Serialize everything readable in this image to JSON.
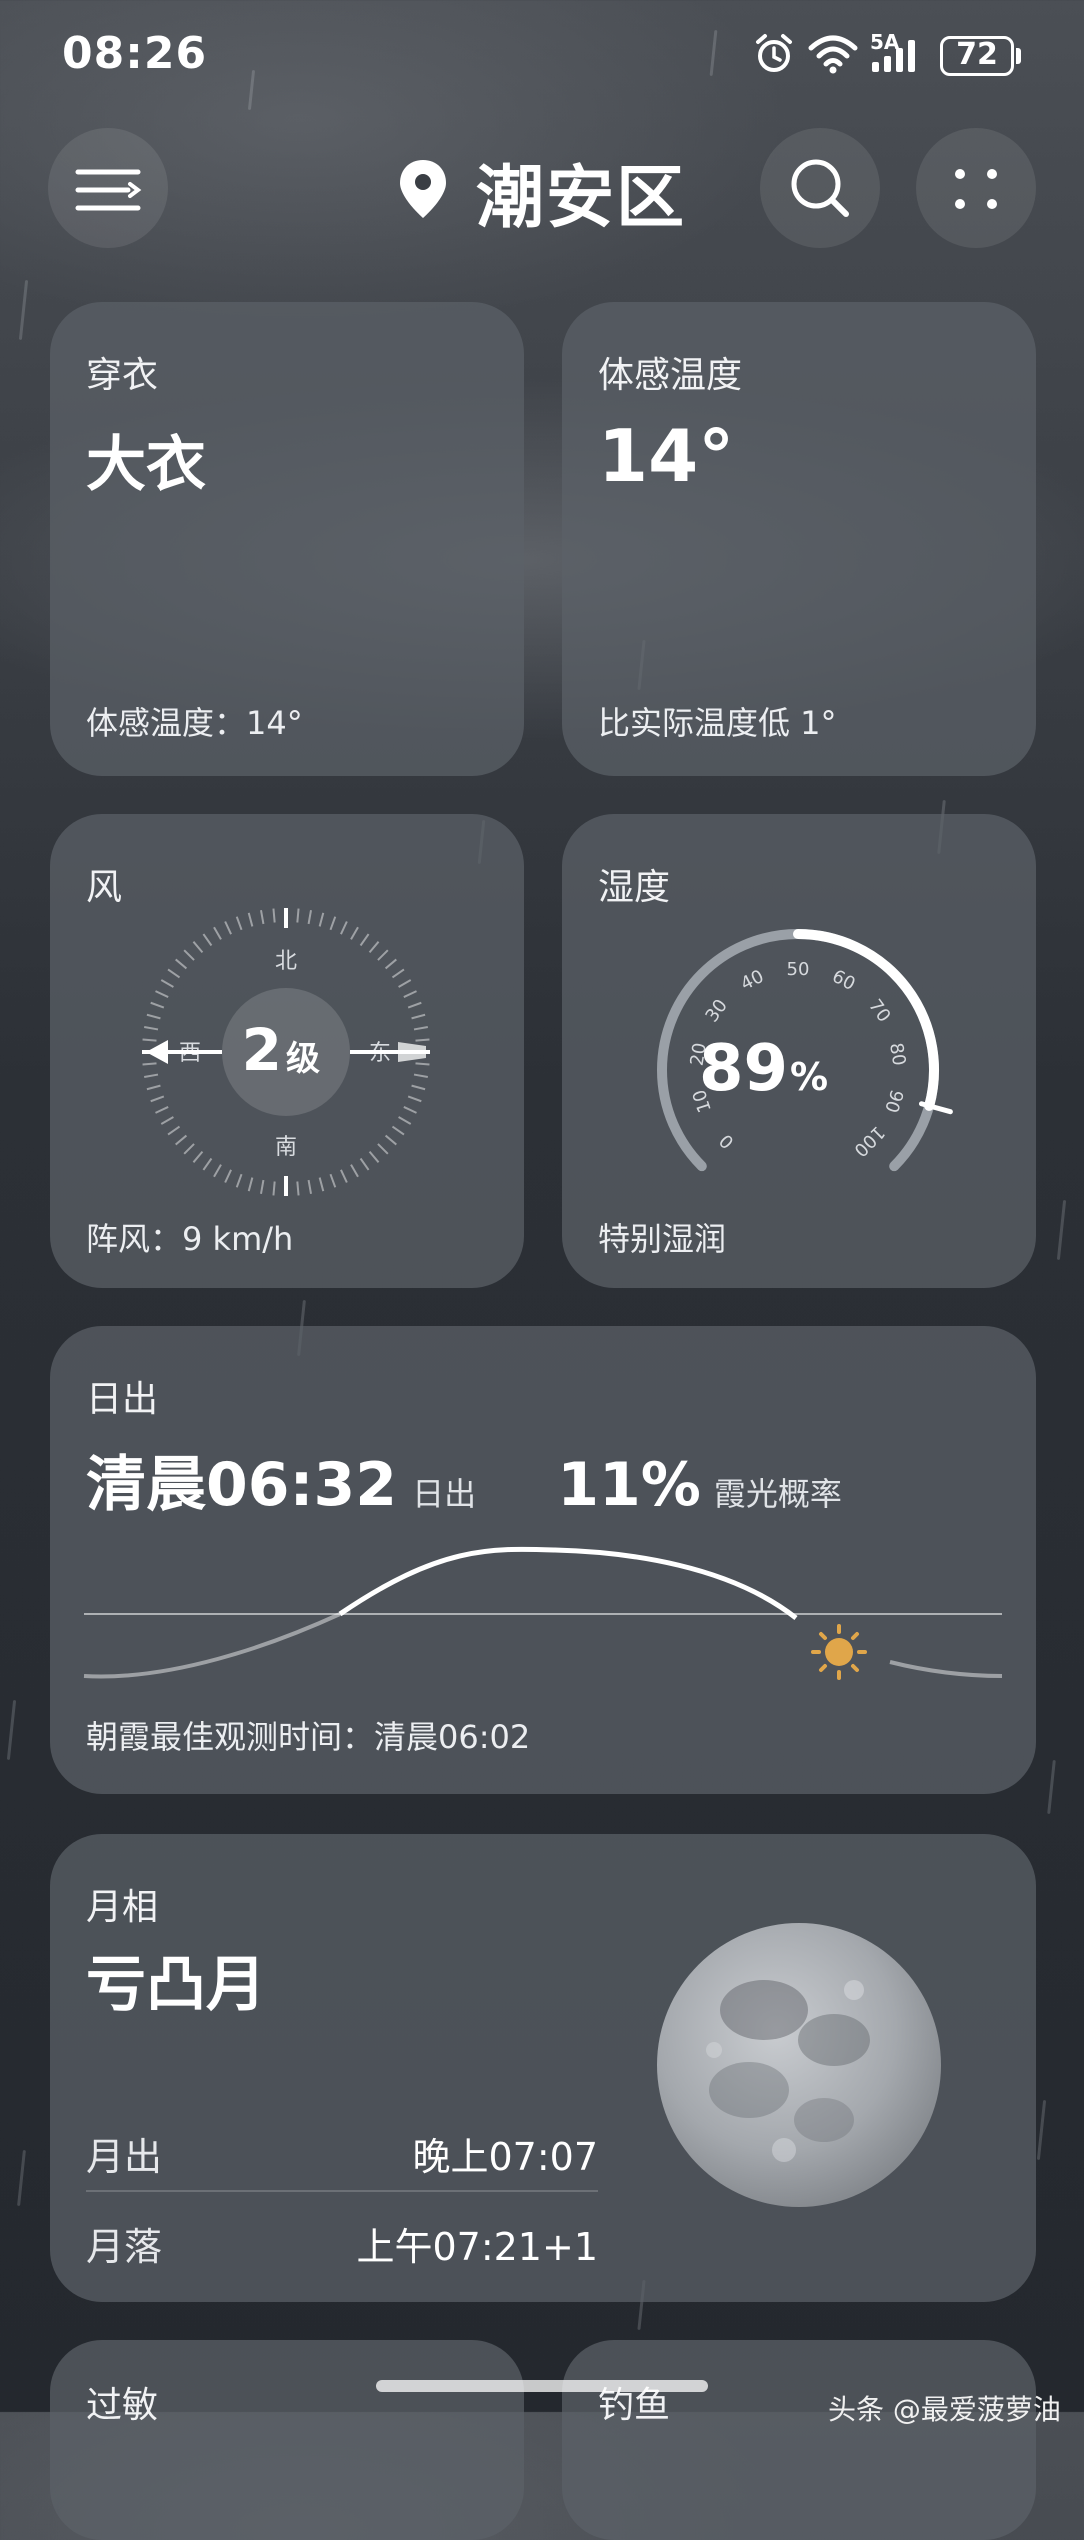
{
  "status_bar": {
    "time": "08:26",
    "network": "5A",
    "battery": "72",
    "icons": [
      "alarm-icon",
      "wifi-icon",
      "signal-icon",
      "battery-icon"
    ]
  },
  "header": {
    "city": "潮安区",
    "icons": [
      "menu-icon",
      "location-pin-icon",
      "search-icon",
      "more-icon"
    ]
  },
  "clothing": {
    "title": "穿衣",
    "value": "大衣",
    "footer": "体感温度：14°"
  },
  "feels_like": {
    "title": "体感温度",
    "value": "14°",
    "footer": "比实际温度低 1°"
  },
  "wind": {
    "title": "风",
    "level_number": "2",
    "level_unit": "级",
    "dir_north": "北",
    "dir_south": "南",
    "dir_west": "西",
    "dir_east": "东",
    "footer": "阵风：9 km/h"
  },
  "humidity": {
    "title": "湿度",
    "value_number": "89",
    "value_unit": "%",
    "level": 89,
    "ticks": [
      "0",
      "10",
      "20",
      "30",
      "40",
      "50",
      "60",
      "70",
      "80",
      "90",
      "100"
    ],
    "footer": "特别湿润"
  },
  "sunrise": {
    "title": "日出",
    "time": "清晨06:32",
    "time_label": "日出",
    "probability": "11%",
    "probability_label": "霞光概率",
    "footer": "朝霞最佳观测时间：清晨06:02"
  },
  "moon": {
    "title": "月相",
    "phase": "亏凸月",
    "rise_label": "月出",
    "rise_value": "晚上07:07",
    "set_label": "月落",
    "set_value": "上午07:21+1"
  },
  "bottom_cards": {
    "left_title": "过敏",
    "right_title": "钓鱼"
  },
  "watermark": "头条 @最爱菠萝油",
  "colors": {
    "sun": "#e0a64a",
    "card": "#5c6168",
    "gauge_track": "#9aa0a7",
    "accent_white": "#ffffff"
  }
}
